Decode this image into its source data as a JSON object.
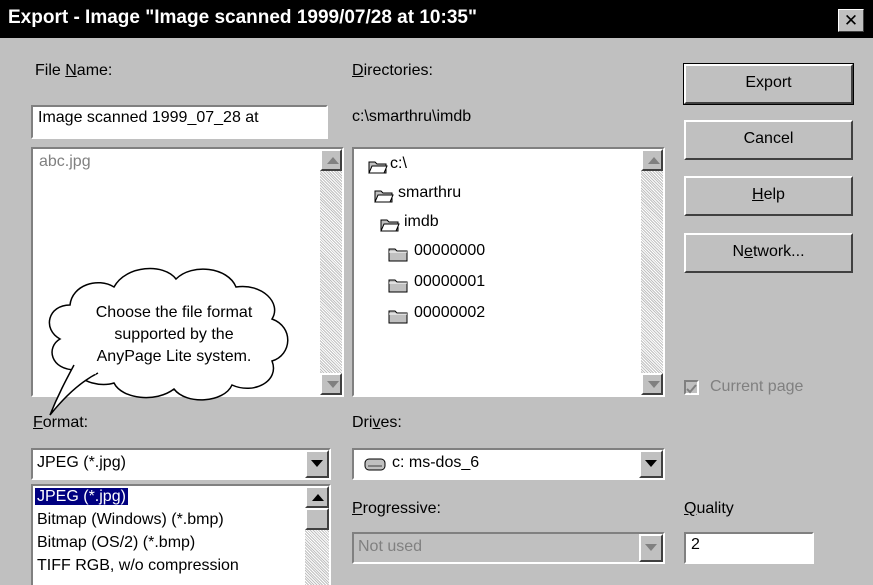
{
  "window": {
    "title": "Export - Image \"Image scanned 1999/07/28 at 10:35\"",
    "close_glyph": "✕"
  },
  "file_name": {
    "label_pre": "File ",
    "label_key": "N",
    "label_post": "ame:",
    "value": "Image scanned 1999_07_28 at",
    "files": [
      "abc.jpg"
    ]
  },
  "directories": {
    "label_key": "D",
    "label_post": "irectories:",
    "path": "c:\\smarthru\\imdb",
    "tree": [
      {
        "name": "c:\\",
        "open": true
      },
      {
        "name": "smarthru",
        "open": true
      },
      {
        "name": "imdb",
        "open": true
      },
      {
        "name": "00000000",
        "open": false
      },
      {
        "name": "00000001",
        "open": false
      },
      {
        "name": "00000002",
        "open": false
      }
    ]
  },
  "buttons": {
    "export": "Export",
    "cancel": "Cancel",
    "help_key": "H",
    "help_post": "elp",
    "network_pre": "N",
    "network_key": "e",
    "network_post": "twork..."
  },
  "current_page": {
    "label": "Current page",
    "checked": true,
    "disabled": true
  },
  "callout": {
    "lines": [
      "Choose the file format",
      "supported by the",
      "AnyPage Lite system."
    ]
  },
  "format": {
    "label_key": "F",
    "label_post": "ormat:",
    "selected": "JPEG (*.jpg)",
    "options": [
      "JPEG (*.jpg)",
      "Bitmap (Windows) (*.bmp)",
      "Bitmap (OS/2) (*.bmp)",
      "TIFF RGB, w/o compression"
    ]
  },
  "drives": {
    "label_pre": "Dri",
    "label_key": "v",
    "label_post": "es:",
    "selected": "c: ms-dos_6"
  },
  "progressive": {
    "label_key": "P",
    "label_post": "rogressive:",
    "selected": "Not used",
    "disabled": true
  },
  "quality": {
    "label_key": "Q",
    "label_post": "uality",
    "value": "2"
  },
  "colors": {
    "face": "#c0c0c0",
    "title_bg": "#000000",
    "highlight": "#000080",
    "disabled_text": "#808080"
  }
}
